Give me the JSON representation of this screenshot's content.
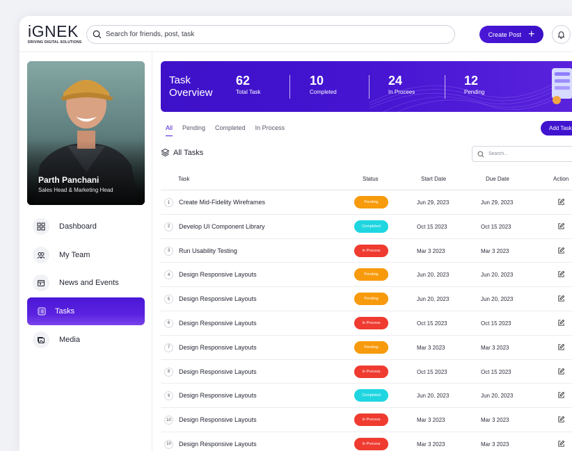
{
  "brand": {
    "name": "iGNEK",
    "tagline": "DRIVING DIGITAL SOLUTIONS"
  },
  "header": {
    "search_placeholder": "Search for friends, post, task",
    "create_post_label": "Create Post"
  },
  "profile": {
    "name": "Parth Panchani",
    "role": "Sales Head & Marketing Head"
  },
  "nav": {
    "items": [
      {
        "label": "Dashboard",
        "icon": "dashboard-icon"
      },
      {
        "label": "My Team",
        "icon": "team-icon"
      },
      {
        "label": "News and Events",
        "icon": "calendar-icon"
      },
      {
        "label": "Tasks",
        "icon": "tasks-icon",
        "active": true
      },
      {
        "label": "Media",
        "icon": "media-icon"
      }
    ]
  },
  "overview": {
    "title_line1": "Task",
    "title_line2": "Overview",
    "stats": [
      {
        "value": "62",
        "label": "Total Task"
      },
      {
        "value": "10",
        "label": "Completed"
      },
      {
        "value": "24",
        "label": "In Procees"
      },
      {
        "value": "12",
        "label": "Pending"
      }
    ]
  },
  "tabs": [
    "All",
    "Pending",
    "Completed",
    "In Process"
  ],
  "add_task_label": "Add Task",
  "list": {
    "title": "All Tasks",
    "search_placeholder": "Search...",
    "columns": {
      "task": "Task",
      "status": "Status",
      "start": "Start Date",
      "due": "Due Date",
      "action": "Action"
    },
    "status_colors": {
      "Pending": "#f79a0c",
      "Completed": "#1fd6e0",
      "In Process": "#ef3b30"
    },
    "rows": [
      {
        "n": "1",
        "task": "Create Mid-Fidelity Wireframes",
        "status": "Pending",
        "start": "Jun 29, 2023",
        "due": "Jun 29, 2023"
      },
      {
        "n": "2",
        "task": "Develop UI Component Library",
        "status": "Completed",
        "start": "Oct 15 2023",
        "due": "Oct 15 2023"
      },
      {
        "n": "3",
        "task": "Run Usability Testing",
        "status": "In Process",
        "start": "Mar 3 2023",
        "due": "Mar 3 2023"
      },
      {
        "n": "4",
        "task": "Design Responsive Layouts",
        "status": "Pending",
        "start": "Jun 20, 2023",
        "due": "Jun 20, 2023"
      },
      {
        "n": "5",
        "task": "Design Responsive Layouts",
        "status": "Pending",
        "start": "Jun 20, 2023",
        "due": "Jun 20, 2023"
      },
      {
        "n": "6",
        "task": "Design Responsive Layouts",
        "status": "In Process",
        "start": "Oct 15 2023",
        "due": "Oct 15 2023"
      },
      {
        "n": "7",
        "task": "Design Responsive Layouts",
        "status": "Pending",
        "start": "Mar 3 2023",
        "due": "Mar 3 2023"
      },
      {
        "n": "8",
        "task": "Design Responsive Layouts",
        "status": "In Process",
        "start": "Oct 15 2023",
        "due": "Oct 15 2023"
      },
      {
        "n": "9",
        "task": "Design Responsive Layouts",
        "status": "Completed",
        "start": "Jun 20, 2023",
        "due": "Jun 20, 2023"
      },
      {
        "n": "10",
        "task": "Design Responsive Layouts",
        "status": "In Process",
        "start": "Mar 3 2023",
        "due": "Mar 3 2023"
      },
      {
        "n": "10",
        "task": "Design Responsive Layouts",
        "status": "In Process",
        "start": "Mar 3 2023",
        "due": "Mar 3 2023"
      }
    ]
  }
}
